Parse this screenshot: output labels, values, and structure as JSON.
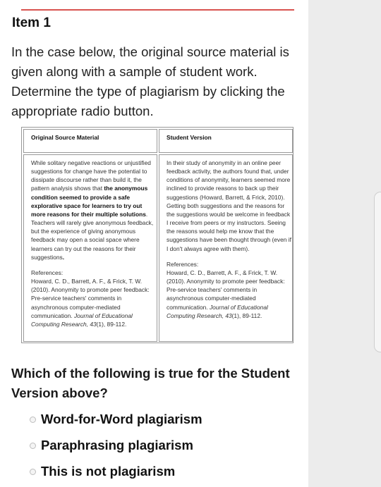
{
  "item_title": "Item 1",
  "instructions": "In the case below, the original source material is given along with a sample of student work. Determine the type of plagiarism by clicking the appropriate radio button.",
  "table": {
    "col1_header": "Original Source Material",
    "col2_header": "Student Version",
    "original": {
      "p1_before": "While solitary negative reactions or unjustified suggestions for change have the potential to dissipate discourse rather than build it, the pattern analysis shows that ",
      "p1_bold": "the anonymous condition seemed to provide a safe explorative space for learners to try out more reasons for their multiple solutions",
      "p1_after": ". Teachers will rarely give anonymous feedback, but the experience of giving anonymous feedback may open a social space where learners can try out the reasons for their suggestions",
      "p1_end": ".",
      "refs_label": "References:",
      "ref_before": "Howard, C. D., Barrett, A. F., & Frick, T. W. (2010). Anonymity to promote peer feedback: Pre-service teachers' comments in asynchronous computer-mediated communication. ",
      "ref_journal": "Journal of Educational Computing Research, 43",
      "ref_after": "(1), 89-112."
    },
    "student": {
      "p1": "In their study of anonymity in an online peer feedback activity, the authors found that, under conditions of anonymity, learners seemed more inclined to provide reasons to back up their suggestions (Howard, Barrett, & Frick, 2010). Getting both suggestions and the reasons for the suggestions would be welcome in feedback I receive from peers or my instructors. Seeing the reasons would help me know that the suggestions have been thought through (even if I don't always agree with them).",
      "refs_label": "References:",
      "ref_before": "Howard, C. D., Barrett, A. F., & Frick, T. W. (2010). Anonymity to promote peer feedback: Pre-service teachers' comments in asynchronous computer-mediated communication. ",
      "ref_journal": "Journal of Educational Computing Research, 43",
      "ref_after": "(1), 89-112."
    }
  },
  "question": "Which of the following is true for the Student Version above?",
  "options": [
    {
      "label": "Word-for-Word plagiarism"
    },
    {
      "label": "Paraphrasing plagiarism"
    },
    {
      "label": "This is not plagiarism"
    }
  ],
  "colors": {
    "accent_rule": "#d9534f",
    "side_panel": "#ececec"
  }
}
